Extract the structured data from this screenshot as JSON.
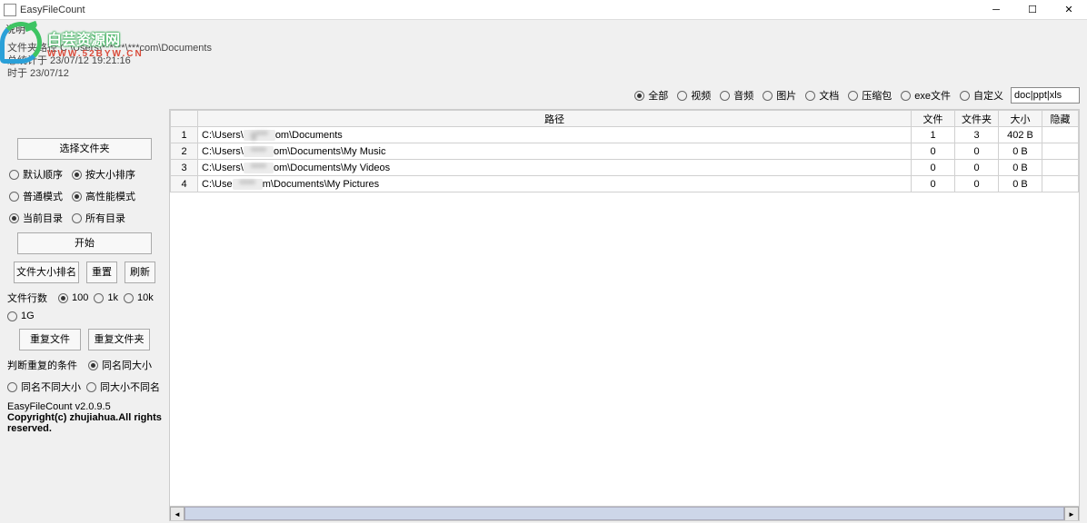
{
  "title": "EasyFileCount",
  "menu": {
    "item1": "说明"
  },
  "info": {
    "line1": "文件夹路径 C:\\Users\\******\\***com\\Documents",
    "line2": "总统计于 23/07/12 19:21:16",
    "line3": "时于 23/07/12"
  },
  "watermark": {
    "text": "白芸资源网",
    "url": "WWW.52BYW.CN"
  },
  "sidebar": {
    "select_folder": "选择文件夹",
    "sort": {
      "default": "默认顺序",
      "size": "按大小排序"
    },
    "mode": {
      "normal": "普通模式",
      "high": "高性能模式"
    },
    "scope": {
      "current": "当前目录",
      "all": "所有目录"
    },
    "start": "开始",
    "rank": "文件大小排名",
    "reset": "重置",
    "refresh": "刷新",
    "rows_label": "文件行数",
    "rows": {
      "r100": "100",
      "r1k": "1k",
      "r10k": "10k",
      "r1g": "1G"
    },
    "dup_file": "重复文件",
    "dup_folder": "重复文件夹",
    "dup_cond_label": "判断重复的条件",
    "dup": {
      "name_size": "同名同大小",
      "name_diff": "同名不同大小",
      "size_diff": "同大小不同名"
    },
    "version": "EasyFileCount v2.0.9.5",
    "copyright": "Copyright(c) zhujiahua.All rights reserved."
  },
  "filters": {
    "all": "全部",
    "video": "视频",
    "audio": "音频",
    "image": "图片",
    "doc": "文档",
    "archive": "压缩包",
    "exe": "exe文件",
    "custom": "自定义",
    "custom_value": "doc|ppt|xls"
  },
  "table": {
    "headers": {
      "path": "路径",
      "files": "文件",
      "folders": "文件夹",
      "size": "大小",
      "hidden": "隐藏"
    },
    "rows": [
      {
        "n": "1",
        "p1": "C:\\Users\\",
        "p2": "g***",
        "p3": "om\\Documents",
        "files": "1",
        "folders": "3",
        "size": "402 B"
      },
      {
        "n": "2",
        "p1": "C:\\Users\\",
        "p2": "****",
        "p3": "om\\Documents\\My Music",
        "files": "0",
        "folders": "0",
        "size": "0 B"
      },
      {
        "n": "3",
        "p1": "C:\\Users\\",
        "p2": "****",
        "p3": "om\\Documents\\My Videos",
        "files": "0",
        "folders": "0",
        "size": "0 B"
      },
      {
        "n": "4",
        "p1": "C:\\Use",
        "p2": "****",
        "p3": "m\\Documents\\My Pictures",
        "files": "0",
        "folders": "0",
        "size": "0 B"
      }
    ]
  }
}
